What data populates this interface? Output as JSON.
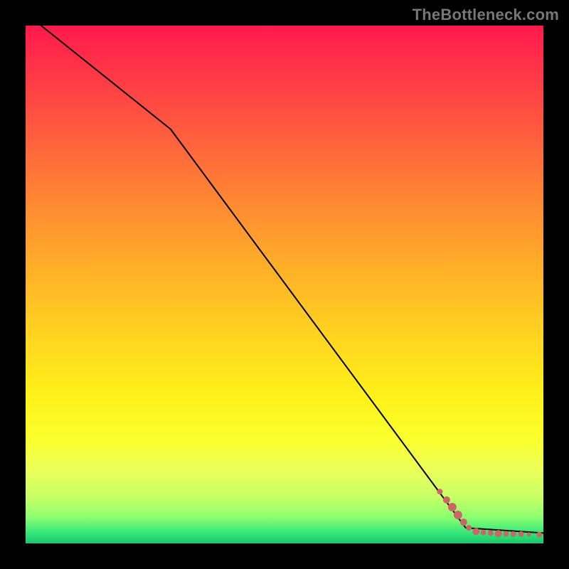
{
  "attribution": "TheBottleneck.com",
  "colors": {
    "dot": "#cc6666",
    "curve": "#000000",
    "frame": "#000000",
    "gradient_top": "#ff1a4d",
    "gradient_mid": "#ffd420",
    "gradient_bottom": "#17c76b"
  },
  "chart_data": {
    "type": "line",
    "title": "",
    "xlabel": "",
    "ylabel": "",
    "xlim": [
      0,
      100
    ],
    "ylim": [
      0,
      100
    ],
    "grid": false,
    "legend": false,
    "curve": {
      "x": [
        3,
        28,
        85,
        100
      ],
      "y": [
        100,
        80,
        3,
        2
      ]
    },
    "scatter": {
      "name": "data-points",
      "points": [
        {
          "x": 80.0,
          "y": 10.0,
          "r": 4
        },
        {
          "x": 81.3,
          "y": 8.4,
          "r": 5
        },
        {
          "x": 82.4,
          "y": 7.0,
          "r": 6
        },
        {
          "x": 83.5,
          "y": 5.5,
          "r": 6
        },
        {
          "x": 84.6,
          "y": 4.1,
          "r": 5
        },
        {
          "x": 85.6,
          "y": 3.0,
          "r": 4
        },
        {
          "x": 87.0,
          "y": 2.3,
          "r": 5
        },
        {
          "x": 88.4,
          "y": 2.1,
          "r": 4
        },
        {
          "x": 89.8,
          "y": 2.0,
          "r": 4
        },
        {
          "x": 91.3,
          "y": 1.9,
          "r": 5
        },
        {
          "x": 92.8,
          "y": 1.85,
          "r": 4
        },
        {
          "x": 94.2,
          "y": 1.8,
          "r": 4
        },
        {
          "x": 95.7,
          "y": 1.8,
          "r": 4
        },
        {
          "x": 97.2,
          "y": 1.75,
          "r": 3
        },
        {
          "x": 99.2,
          "y": 1.7,
          "r": 4
        }
      ]
    }
  }
}
